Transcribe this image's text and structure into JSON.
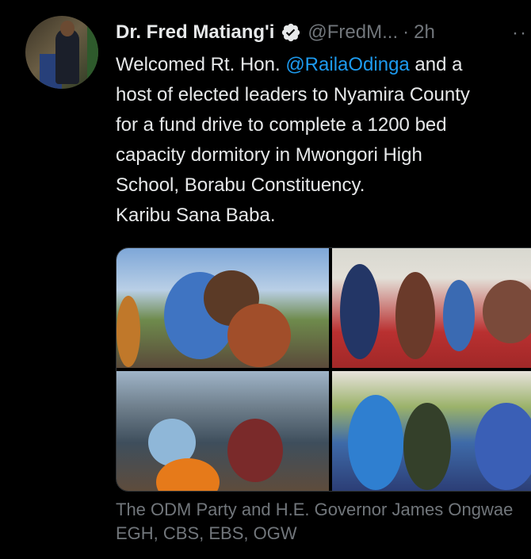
{
  "tweet": {
    "author_name": "Dr. Fred Matiang'i",
    "handle": "@FredM...",
    "separator": "·",
    "time": "2h",
    "more": "··",
    "text_lines": [
      {
        "before": "Welcomed Rt. Hon. ",
        "mention": "@RailaOdinga",
        "after": " and a"
      },
      {
        "before": "host of elected leaders to Nyamira County",
        "mention": "",
        "after": ""
      },
      {
        "before": "for a fund drive to complete a 1200 bed",
        "mention": "",
        "after": ""
      },
      {
        "before": "capacity dormitory in Mwongori High",
        "mention": "",
        "after": ""
      },
      {
        "before": "School, Borabu Constituency.",
        "mention": "",
        "after": ""
      },
      {
        "before": "Karibu Sana Baba.",
        "mention": "",
        "after": ""
      }
    ],
    "media_caption_lines": [
      "The ODM Party and H.E. Governor James Ongwae",
      "EGH, CBS, EBS, OGW"
    ],
    "icons": {
      "avatar": "profile-photo",
      "verified": "verified-badge-icon",
      "more": "more-options-icon"
    },
    "colors": {
      "background": "#000000",
      "text": "#e7e9ea",
      "muted": "#71767b",
      "link": "#1d9bf0"
    }
  }
}
